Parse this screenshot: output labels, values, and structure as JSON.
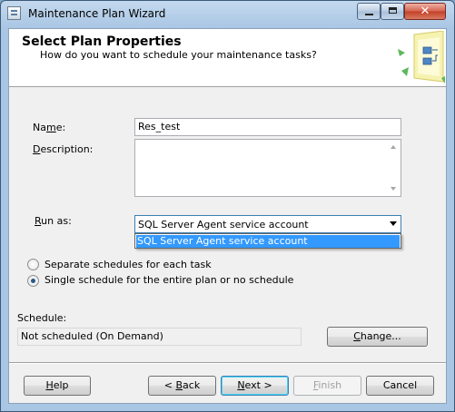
{
  "window": {
    "title": "Maintenance Plan Wizard"
  },
  "header": {
    "title": "Select Plan Properties",
    "subtitle": "How do you want to schedule your maintenance tasks?"
  },
  "form": {
    "name_label_pre": "Na",
    "name_label_u": "m",
    "name_label_post": "e:",
    "name_value": "Res_test",
    "description_label_u": "D",
    "description_label_post": "escription:",
    "description_value": "",
    "runas_label_u": "R",
    "runas_label_post": "un as:",
    "runas_selected": "SQL Server Agent service account",
    "runas_options": [
      "SQL Server Agent service account"
    ]
  },
  "schedule_options": {
    "separate": "Separate schedules for each task",
    "single": "Single schedule for the entire plan or no schedule",
    "selected": "single"
  },
  "schedule": {
    "label": "Schedule:",
    "value": "Not scheduled (On Demand)",
    "change_pre": "",
    "change_u": "C",
    "change_post": "hange..."
  },
  "buttons": {
    "help_u": "H",
    "help_post": "elp",
    "back_pre": "< ",
    "back_u": "B",
    "back_post": "ack",
    "next_u": "N",
    "next_post": "ext >",
    "finish_u": "F",
    "finish_post": "inish",
    "cancel": "Cancel"
  }
}
